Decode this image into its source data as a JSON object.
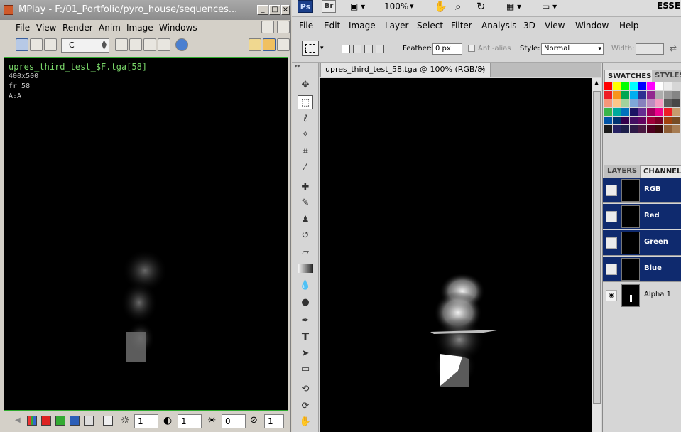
{
  "mplay": {
    "title": "MPlay - F:/01_Portfolio/pyro_house/sequences...",
    "menu": [
      "File",
      "View",
      "Render",
      "Anim",
      "Image",
      "Windows"
    ],
    "channel_combo": "C",
    "overlay": {
      "filename": "upres_third_test_$F.tga[58]",
      "resolution": "400x500",
      "frame": "fr 58",
      "channel": "A:A"
    },
    "bottom": {
      "gamma": "1",
      "contrast": "1",
      "offset": "0",
      "lut": "1"
    }
  },
  "photoshop": {
    "app_logo": "Ps",
    "bridge_logo": "Br",
    "zoom": "100%",
    "workspace": "ESSEN",
    "menu": [
      "File",
      "Edit",
      "Image",
      "Layer",
      "Select",
      "Filter",
      "Analysis",
      "3D",
      "View",
      "Window",
      "Help"
    ],
    "options": {
      "feather_label": "Feather:",
      "feather_value": "0 px",
      "antialias_label": "Anti-alias",
      "style_label": "Style:",
      "style_value": "Normal",
      "width_label": "Width:"
    },
    "document_tab": "upres_third_test_58.tga @ 100% (RGB/8)",
    "close_glyph": "×",
    "panels": {
      "swatches_tab": "SWATCHES",
      "styles_tab": "STYLES",
      "layers_tab": "LAYERS",
      "channels_tab": "CHANNELS",
      "channels": [
        {
          "name": "RGB",
          "selected": true,
          "visible": false
        },
        {
          "name": "Red",
          "selected": true,
          "visible": false
        },
        {
          "name": "Green",
          "selected": true,
          "visible": false
        },
        {
          "name": "Blue",
          "selected": true,
          "visible": false
        },
        {
          "name": "Alpha 1",
          "selected": false,
          "visible": true
        }
      ]
    }
  },
  "colors": {
    "mplay_border": "#2eaa2e",
    "ps_selection": "#0f2a6e",
    "overlay_text": "#7ad86a"
  }
}
